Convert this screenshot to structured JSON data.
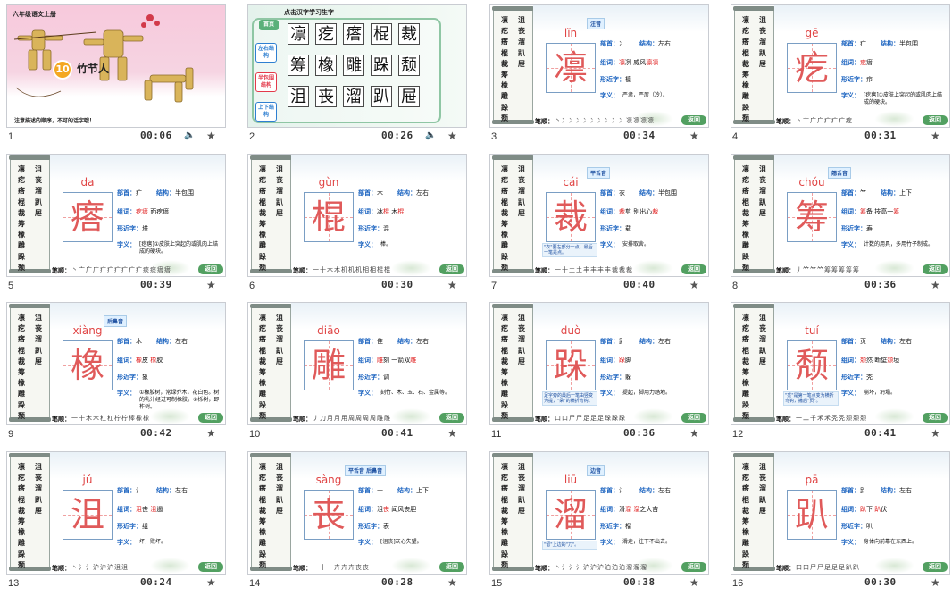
{
  "slides": [
    {
      "num": "1",
      "duration": "00:06",
      "audio": true,
      "title": "六年级语文上册",
      "lesson_number": "10",
      "lesson_name": "竹节人",
      "tip": "注意描述的顺序，不可的话字哦！"
    },
    {
      "num": "2",
      "duration": "00:26",
      "audio": true,
      "header": "点击汉字学习生字",
      "label_top": "首页",
      "groups": [
        {
          "label": "左右结构",
          "color": "#2e7fd1"
        },
        {
          "label": "半包围结构",
          "color": "#e3394a"
        },
        {
          "label": "上下结构",
          "color": "#2e7fd1"
        }
      ],
      "chars": [
        "凛",
        "疙",
        "瘩",
        "棍",
        "裁",
        "筹",
        "橡",
        "雕",
        "跺",
        "颓",
        "沮",
        "丧",
        "溜",
        "趴",
        "屉"
      ]
    },
    {
      "num": "3",
      "duration": "00:34",
      "pinyin": "lǐn",
      "char": "凛",
      "radical": "冫",
      "structure": "左右",
      "words": [
        {
          "t": "凛",
          "r": true
        },
        {
          "t": "冽  威风"
        },
        {
          "t": "凛凛",
          "r": true
        }
      ],
      "similar": "檩",
      "meaning": "严肃，严厉（冷）。",
      "tag": "注音",
      "strokes": "丶冫冫冫冫冫冫冫冫冫凛凛凛凛"
    },
    {
      "num": "4",
      "duration": "00:31",
      "pinyin": "gē",
      "char": "疙",
      "radical": "疒",
      "structure": "半包围",
      "words": [
        {
          "t": "疙",
          "r": true
        },
        {
          "t": "瘩"
        }
      ],
      "similar": "疖",
      "meaning": "[疙瘩]①皮肤上突起的或肌肉上结成的硬块。",
      "strokes": "丶亠广广疒疒疒疙"
    },
    {
      "num": "5",
      "duration": "00:39",
      "pinyin": "da",
      "char": "瘩",
      "radical": "疒",
      "structure": "半包围",
      "words": [
        {
          "t": "疙瘩",
          "r": true
        },
        {
          "t": "  面疙瘩"
        }
      ],
      "similar": "塔",
      "meaning": "[疙瘩]①皮肤上突起的或肌肉上结成的硬块。",
      "strokes": "丶亠广广疒疒疒疒疒疒痰痰瘩瘩"
    },
    {
      "num": "6",
      "duration": "00:30",
      "pinyin": "gùn",
      "char": "棍",
      "radical": "木",
      "structure": "左右",
      "words": [
        {
          "t": "冰"
        },
        {
          "t": "棍",
          "r": true
        },
        {
          "t": "  木"
        },
        {
          "t": "棍",
          "r": true
        }
      ],
      "similar": "混",
      "meaning": "棒。",
      "strokes": "一十木木机机机相相棍棍"
    },
    {
      "num": "7",
      "duration": "00:40",
      "pinyin": "cái",
      "char": "裁",
      "radical": "衣",
      "structure": "半包围",
      "words": [
        {
          "t": "裁",
          "r": true
        },
        {
          "t": "剪  别出心"
        },
        {
          "t": "裁",
          "r": true
        }
      ],
      "similar": "载",
      "meaning": "安排取舍。",
      "tag": "平舌音",
      "note": "\"衣\"要左部分一点，最后一笔是点。",
      "strokes": "一十土土丰丰丰丰裁裁裁"
    },
    {
      "num": "8",
      "duration": "00:36",
      "pinyin": "chóu",
      "char": "筹",
      "radical": "⺮",
      "structure": "上下",
      "words": [
        {
          "t": "筹",
          "r": true
        },
        {
          "t": "备  技高一"
        },
        {
          "t": "筹",
          "r": true
        }
      ],
      "similar": "寿",
      "meaning": "计数的用具，多用竹子制成。",
      "tag": "翘舌音",
      "strokes": "丿⺮⺮⺮筹筹筹筹筹"
    },
    {
      "num": "9",
      "duration": "00:42",
      "pinyin": "xiàng",
      "char": "橡",
      "radical": "木",
      "structure": "左右",
      "words": [
        {
          "t": "橡",
          "r": true
        },
        {
          "t": "皮  "
        },
        {
          "t": "橡",
          "r": true
        },
        {
          "t": "胶"
        }
      ],
      "similar": "象",
      "meaning": "①橡胶树，常绿乔木，花白色。树的乳汁经过可制橡胶。②栎树，即柞树。",
      "tag": "后鼻音",
      "strokes": "一十木木杠杠柠柠棒橡橡"
    },
    {
      "num": "10",
      "duration": "00:41",
      "pinyin": "diāo",
      "char": "雕",
      "radical": "隹",
      "structure": "左右",
      "words": [
        {
          "t": "雕",
          "r": true
        },
        {
          "t": "刻  一箭双"
        },
        {
          "t": "雕",
          "r": true
        }
      ],
      "similar": "调",
      "meaning": "刻竹、木、玉、石、金属等。",
      "strokes": "丿刀月月用周周周周雕雕"
    },
    {
      "num": "11",
      "duration": "00:36",
      "pinyin": "duò",
      "char": "跺",
      "radical": "⻊",
      "structure": "左右",
      "words": [
        {
          "t": "跺",
          "r": true
        },
        {
          "t": "脚"
        }
      ],
      "similar": "躲",
      "meaning": "提起，脚用力踏地。",
      "note": "足字旁的最后一笔由竖变为提，\"朵\"的横折弯钩。",
      "strokes": "口口尸尸足足足跺跺跺"
    },
    {
      "num": "12",
      "duration": "00:41",
      "pinyin": "tuí",
      "char": "颓",
      "radical": "页",
      "structure": "左右",
      "words": [
        {
          "t": "颓",
          "r": true
        },
        {
          "t": "然  断壁"
        },
        {
          "t": "颓",
          "r": true
        },
        {
          "t": "垣"
        }
      ],
      "similar": "秃",
      "meaning": "崩坏，坍塌。",
      "note": "\"秃\"是第一笔点变为横折弯钩，撇后\"页\"。",
      "strokes": "一二千禾禾秃秃颓颓颓"
    },
    {
      "num": "13",
      "duration": "00:24",
      "pinyin": "jǔ",
      "char": "沮",
      "radical": "氵",
      "structure": "左右",
      "words": [
        {
          "t": "沮",
          "r": true
        },
        {
          "t": "丧  "
        },
        {
          "t": "沮",
          "r": true
        },
        {
          "t": "遏"
        }
      ],
      "similar": "组",
      "meaning": "坏，败坏。",
      "strokes": "丶氵氵沪沪沪沮沮"
    },
    {
      "num": "14",
      "duration": "00:28",
      "pinyin": "sàng",
      "char": "丧",
      "radical": "十",
      "structure": "上下",
      "words": [
        {
          "t": "沮"
        },
        {
          "t": "丧",
          "r": true
        },
        {
          "t": "  闻风丧胆"
        }
      ],
      "similar": "表",
      "meaning": "[沮丧]灰心失望。",
      "tag": "平舌音 后鼻音",
      "strokes": "一十十卉卉卉丧丧"
    },
    {
      "num": "15",
      "duration": "00:38",
      "pinyin": "liū",
      "char": "溜",
      "radical": "氵",
      "structure": "左右",
      "words": [
        {
          "t": "滑"
        },
        {
          "t": "溜",
          "r": true
        },
        {
          "t": "  "
        },
        {
          "t": "溜",
          "r": true
        },
        {
          "t": "之大吉"
        }
      ],
      "similar": "榴",
      "meaning": "滑走，往下不出去。",
      "tag": "边音",
      "note": "\"留\"上边的\"刀\"。",
      "strokes": "丶氵氵氵沪沪沪泊泊泊溜溜溜"
    },
    {
      "num": "16",
      "duration": "00:30",
      "pinyin": "pā",
      "char": "趴",
      "radical": "⻊",
      "structure": "左右",
      "words": [
        {
          "t": "趴",
          "r": true
        },
        {
          "t": "下  "
        },
        {
          "t": "趴",
          "r": true
        },
        {
          "t": "伏"
        }
      ],
      "similar": "叭",
      "meaning": "身体向前靠在东西上。",
      "strokes": "口口尸尸足足足趴趴"
    }
  ],
  "labels": {
    "radical": "部首：",
    "structure": "结构：",
    "words": "组词：",
    "similar": "形近字：",
    "meaning": "字义：",
    "bishun": "笔顺：",
    "back": "返回"
  },
  "scroll_left": [
    "凛",
    "疙",
    "瘩",
    "棍",
    "裁",
    "筹",
    "橡",
    "雕",
    "跺",
    "颓"
  ],
  "scroll_right": [
    "沮",
    "丧",
    "溜",
    "趴",
    "屉"
  ]
}
